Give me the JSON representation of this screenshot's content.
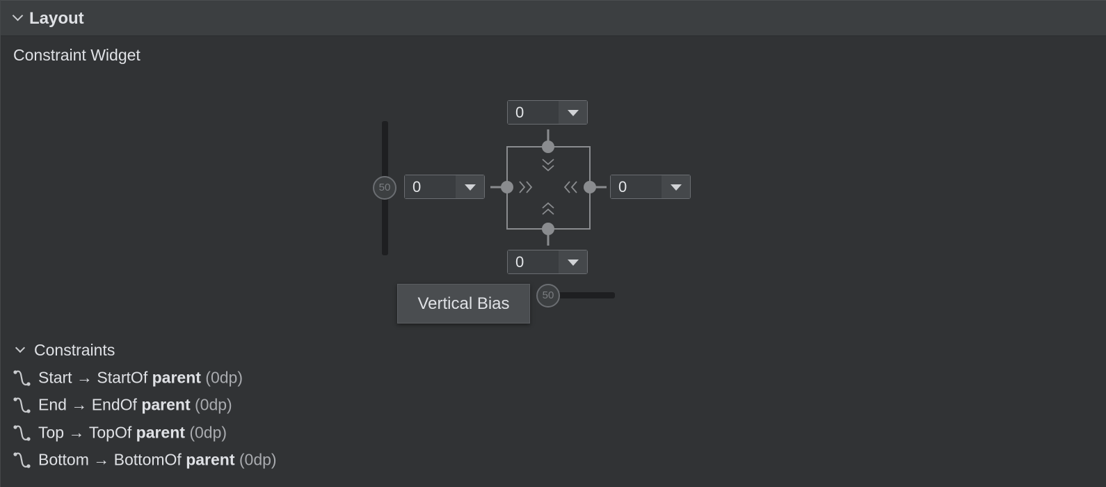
{
  "section": {
    "title": "Layout",
    "widget_label": "Constraint Widget"
  },
  "constraint_widget": {
    "vertical_bias": "50",
    "horizontal_bias": "50",
    "margins": {
      "top": "0",
      "left": "0",
      "right": "0",
      "bottom": "0"
    },
    "tooltip": "Vertical Bias"
  },
  "constraints": {
    "title": "Constraints",
    "items": [
      {
        "side": "Start",
        "arrow": "→",
        "target": "StartOf",
        "ref": "parent",
        "margin": "(0dp)"
      },
      {
        "side": "End",
        "arrow": "→",
        "target": "EndOf",
        "ref": "parent",
        "margin": "(0dp)"
      },
      {
        "side": "Top",
        "arrow": "→",
        "target": "TopOf",
        "ref": "parent",
        "margin": "(0dp)"
      },
      {
        "side": "Bottom",
        "arrow": "→",
        "target": "BottomOf",
        "ref": "parent",
        "margin": "(0dp)"
      }
    ]
  },
  "icons": {
    "collapse": "chevron-down-icon",
    "constraint": "constraint-link-icon"
  },
  "colors": {
    "background": "#313335",
    "header": "#3c3f41",
    "widget_stroke": "#8a8c8f",
    "text": "#dfe1e5"
  }
}
